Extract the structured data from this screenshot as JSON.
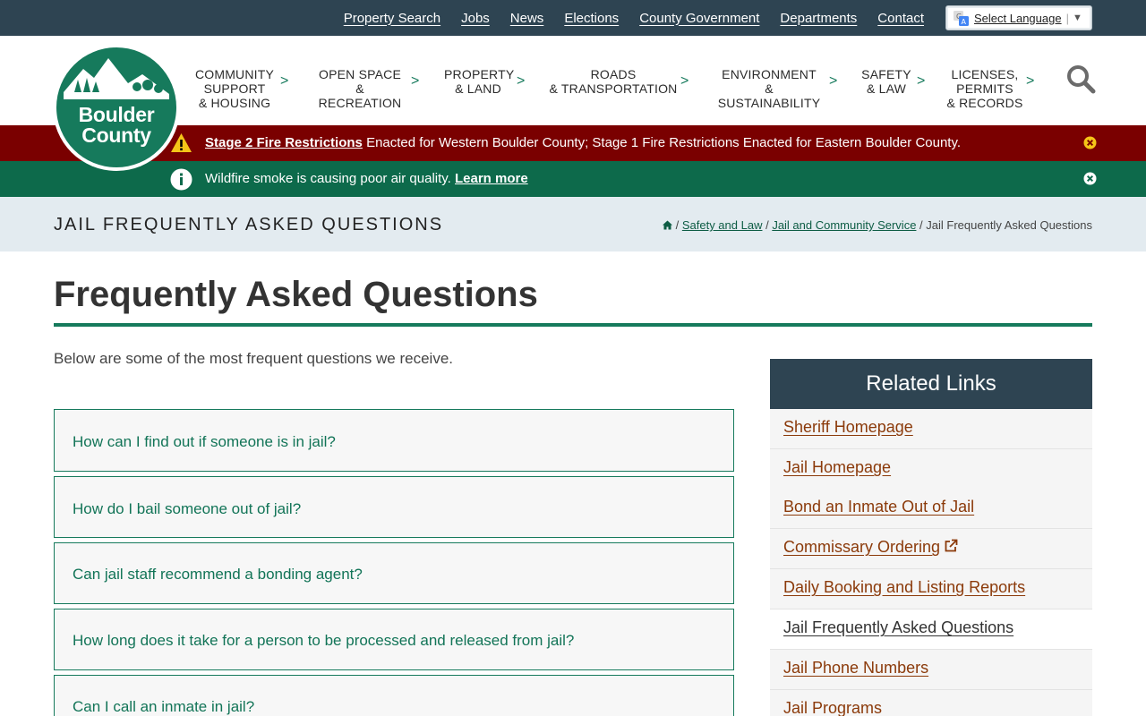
{
  "topbar": {
    "links": [
      "Property Search",
      "Jobs",
      "News",
      "Elections",
      "County Government",
      "Departments",
      "Contact"
    ],
    "language_label": "Select Language"
  },
  "logo": {
    "line1": "Boulder",
    "line2": "County"
  },
  "nav": [
    {
      "lines": [
        "COMMUNITY",
        "SUPPORT",
        "& HOUSING"
      ]
    },
    {
      "lines": [
        "OPEN SPACE",
        "& RECREATION"
      ]
    },
    {
      "lines": [
        "PROPERTY",
        "& LAND"
      ]
    },
    {
      "lines": [
        "ROADS",
        "& TRANSPORTATION"
      ]
    },
    {
      "lines": [
        "ENVIRONMENT",
        "& SUSTAINABILITY"
      ]
    },
    {
      "lines": [
        "SAFETY",
        "& LAW"
      ]
    },
    {
      "lines": [
        "LICENSES,",
        "PERMITS",
        "& RECORDS"
      ]
    }
  ],
  "nav_chevron": ">",
  "alerts": {
    "fire": {
      "link": "Stage 2 Fire Restrictions",
      "text": " Enacted for Western Boulder County; Stage 1 Fire Restrictions Enacted for Eastern Boulder County."
    },
    "smoke": {
      "text": "Wildfire smoke is causing poor air quality. ",
      "link": "Learn more"
    }
  },
  "breadcrumb_band": {
    "title": "JAIL FREQUENTLY ASKED QUESTIONS",
    "sep": " / ",
    "crumbs": [
      "Safety and Law",
      "Jail and Community Service"
    ],
    "current": "Jail Frequently Asked Questions"
  },
  "main": {
    "title": "Frequently Asked Questions",
    "intro": "Below are some of the most frequent questions we receive.",
    "faqs": [
      "How can I find out if someone is in jail?",
      "How do I bail someone out of jail?",
      "Can jail staff recommend a bonding agent?",
      "How long does it take for a person to be processed and released from jail?",
      "Can I call an inmate in jail?"
    ]
  },
  "sidebar": {
    "heading": "Related Links",
    "links": [
      "Sheriff Homepage",
      "Jail Homepage",
      "Bond an Inmate Out of Jail",
      "Commissary Ordering",
      "Daily Booking and Listing Reports",
      "Jail Frequently Asked Questions",
      "Jail Phone Numbers",
      "Jail Programs"
    ]
  },
  "colors": {
    "topbar": "#2e4452",
    "brand_green": "#167a5c",
    "alert_red": "#7a0000",
    "alert_green": "#0d6a4b",
    "link_brown": "#8b3a0a",
    "band": "#e3ebf0"
  }
}
